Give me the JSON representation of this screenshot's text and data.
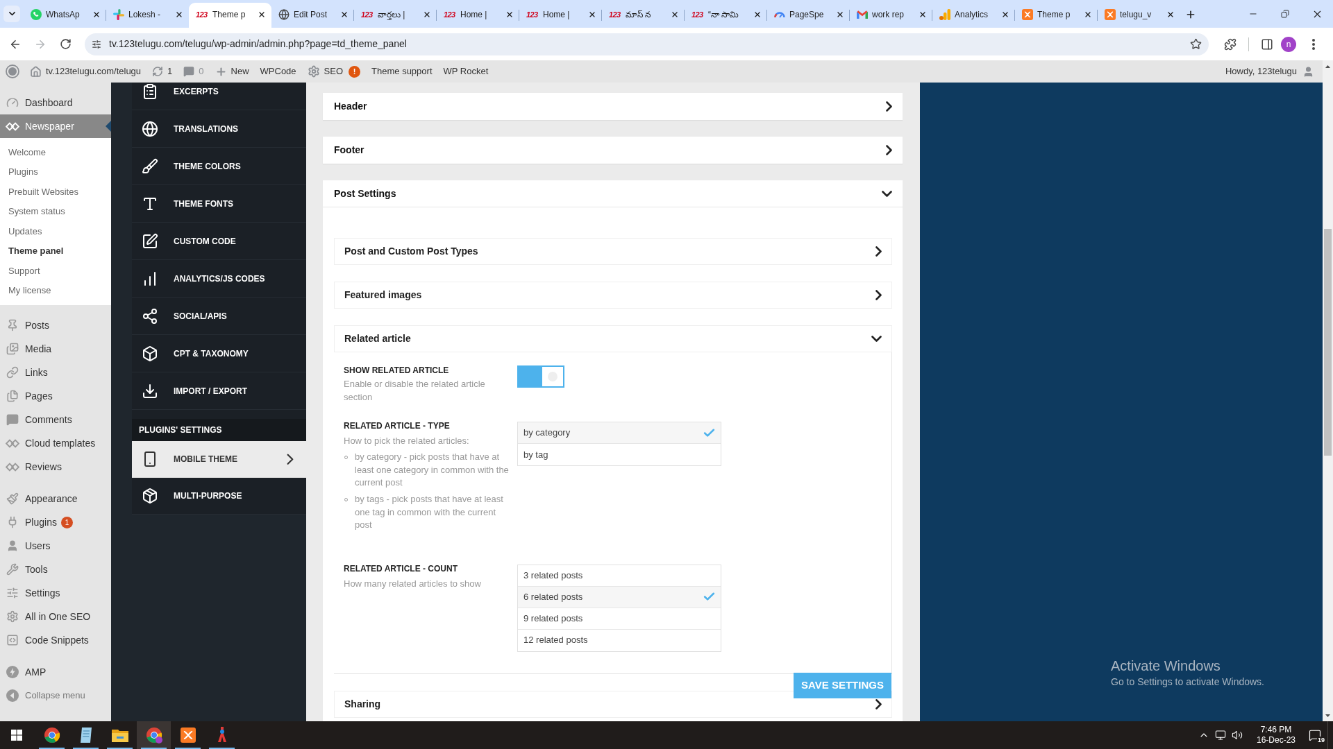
{
  "browser": {
    "tabs": [
      {
        "title": "WhatsAp",
        "selected": false
      },
      {
        "title": "Lokesh -",
        "selected": false
      },
      {
        "title": "Theme p",
        "favicon_text": "123",
        "selected": true
      },
      {
        "title": "Edit Post",
        "selected": false
      },
      {
        "title": "వార్తలు |",
        "favicon_text": "123",
        "selected": false
      },
      {
        "title": "Home |",
        "favicon_text": "123",
        "selected": false
      },
      {
        "title": "Home |",
        "favicon_text": "123",
        "selected": false
      },
      {
        "title": "మాస్ న",
        "favicon_text": "123",
        "selected": false
      },
      {
        "title": "“నా సామి",
        "favicon_text": "123",
        "selected": false
      },
      {
        "title": "PageSpe",
        "selected": false
      },
      {
        "title": "work rep",
        "selected": false
      },
      {
        "title": "Analytics",
        "selected": false
      },
      {
        "title": "Theme p",
        "selected": false
      },
      {
        "title": "telugu_v",
        "selected": false
      }
    ],
    "forward_disabled": true,
    "address": "tv.123telugu.com/telugu/wp-admin/admin.php?page=td_theme_panel",
    "profile_initial": "n"
  },
  "admin_bar": {
    "items": [
      {
        "label": "tv.123telugu.com/telugu",
        "dimmed": false
      },
      {
        "label": "1",
        "dimmed": false
      },
      {
        "label": "0",
        "dimmed": true
      },
      {
        "label": "New",
        "dimmed": false
      },
      {
        "label": "WPCode",
        "dimmed": false
      },
      {
        "label": "SEO",
        "badge": "!",
        "dimmed": false
      },
      {
        "label": "Theme support",
        "dimmed": false
      },
      {
        "label": "WP Rocket",
        "dimmed": false
      }
    ],
    "account": "Howdy, 123telugu"
  },
  "wp_menu": {
    "groups": [
      {
        "items": [
          {
            "label": "Dashboard",
            "selected": false
          },
          {
            "label": "Newspaper",
            "selected": true,
            "children": [
              {
                "label": "Welcome",
                "selected": false
              },
              {
                "label": "Plugins",
                "selected": false
              },
              {
                "label": "Prebuilt Websites",
                "selected": false
              },
              {
                "label": "System status",
                "selected": false
              },
              {
                "label": "Updates",
                "selected": false
              },
              {
                "label": "Theme panel",
                "selected": true
              },
              {
                "label": "Support",
                "selected": false
              },
              {
                "label": "My license",
                "selected": false
              }
            ]
          }
        ]
      },
      {
        "items": [
          {
            "label": "Posts",
            "selected": false
          },
          {
            "label": "Media",
            "selected": false
          },
          {
            "label": "Links",
            "selected": false
          },
          {
            "label": "Pages",
            "selected": false
          },
          {
            "label": "Comments",
            "selected": false
          },
          {
            "label": "Cloud templates",
            "selected": false
          },
          {
            "label": "Reviews",
            "selected": false
          }
        ]
      },
      {
        "items": [
          {
            "label": "Appearance",
            "selected": false
          },
          {
            "label": "Plugins",
            "badge": "1",
            "selected": false
          },
          {
            "label": "Users",
            "selected": false
          },
          {
            "label": "Tools",
            "selected": false
          },
          {
            "label": "Settings",
            "selected": false
          },
          {
            "label": "All in One SEO",
            "selected": false
          },
          {
            "label": "Code Snippets",
            "selected": false
          }
        ]
      },
      {
        "items": [
          {
            "label": "AMP",
            "selected": false
          }
        ]
      }
    ],
    "collapse": "Collapse menu"
  },
  "theme_panel": {
    "menu": [
      {
        "label": "EXCERPTS",
        "selected": false
      },
      {
        "label": "TRANSLATIONS",
        "selected": false
      },
      {
        "label": "THEME COLORS",
        "selected": false
      },
      {
        "label": "THEME FONTS",
        "selected": false
      },
      {
        "label": "CUSTOM CODE",
        "selected": false
      },
      {
        "label": "ANALYTICS/JS CODES",
        "selected": false
      },
      {
        "label": "SOCIAL/APIS",
        "selected": false
      },
      {
        "label": "CPT & TAXONOMY",
        "selected": false
      },
      {
        "label": "IMPORT / EXPORT",
        "selected": false
      }
    ],
    "plugins_heading": "PLUGINS' SETTINGS",
    "plugin_menu": [
      {
        "label": "MOBILE THEME",
        "selected": true
      },
      {
        "label": "MULTI-PURPOSE",
        "selected": false
      }
    ],
    "sections": [
      {
        "title": "Header",
        "expanded": false
      },
      {
        "title": "Footer",
        "expanded": false
      },
      {
        "title": "Post Settings",
        "expanded": true,
        "subsections": [
          {
            "title": "Post and Custom Post Types",
            "expanded": false
          },
          {
            "title": "Featured images",
            "expanded": false
          },
          {
            "title": "Related article",
            "expanded": true,
            "settings": [
              {
                "kind": "toggle",
                "label": "SHOW RELATED ARTICLE",
                "description": "Enable or disable the related article section",
                "on": true
              },
              {
                "kind": "choice",
                "label": "RELATED ARTICLE - TYPE",
                "description": "How to pick the related articles:",
                "notes": [
                  "by category - pick posts that have at least one category in common with the current post",
                  "by tags - pick posts that have at least one tag in common with the current post"
                ],
                "options": [
                  {
                    "label": "by category",
                    "selected": true
                  },
                  {
                    "label": "by tag",
                    "selected": false
                  }
                ]
              },
              {
                "kind": "choice",
                "label": "RELATED ARTICLE - COUNT",
                "description": "How many related articles to show",
                "options": [
                  {
                    "label": "3 related posts",
                    "selected": false
                  },
                  {
                    "label": "6 related posts",
                    "selected": true
                  },
                  {
                    "label": "9 related posts",
                    "selected": false
                  },
                  {
                    "label": "12 related posts",
                    "selected": false
                  }
                ]
              }
            ]
          },
          {
            "title": "Sharing",
            "expanded": false
          }
        ]
      }
    ],
    "save_button": "SAVE SETTINGS"
  },
  "os_notice": {
    "title": "Activate Windows",
    "message": "Go to Settings to activate Windows."
  },
  "taskbar": {
    "apps": [
      {
        "running": true,
        "selected": false
      },
      {
        "running": true,
        "selected": false
      },
      {
        "running": true,
        "selected": false
      },
      {
        "running": true,
        "selected": true
      },
      {
        "running": true,
        "selected": false
      },
      {
        "running": true,
        "selected": false
      }
    ],
    "time": "7:46 PM",
    "date": "16-Dec-23",
    "notifications": "19"
  }
}
